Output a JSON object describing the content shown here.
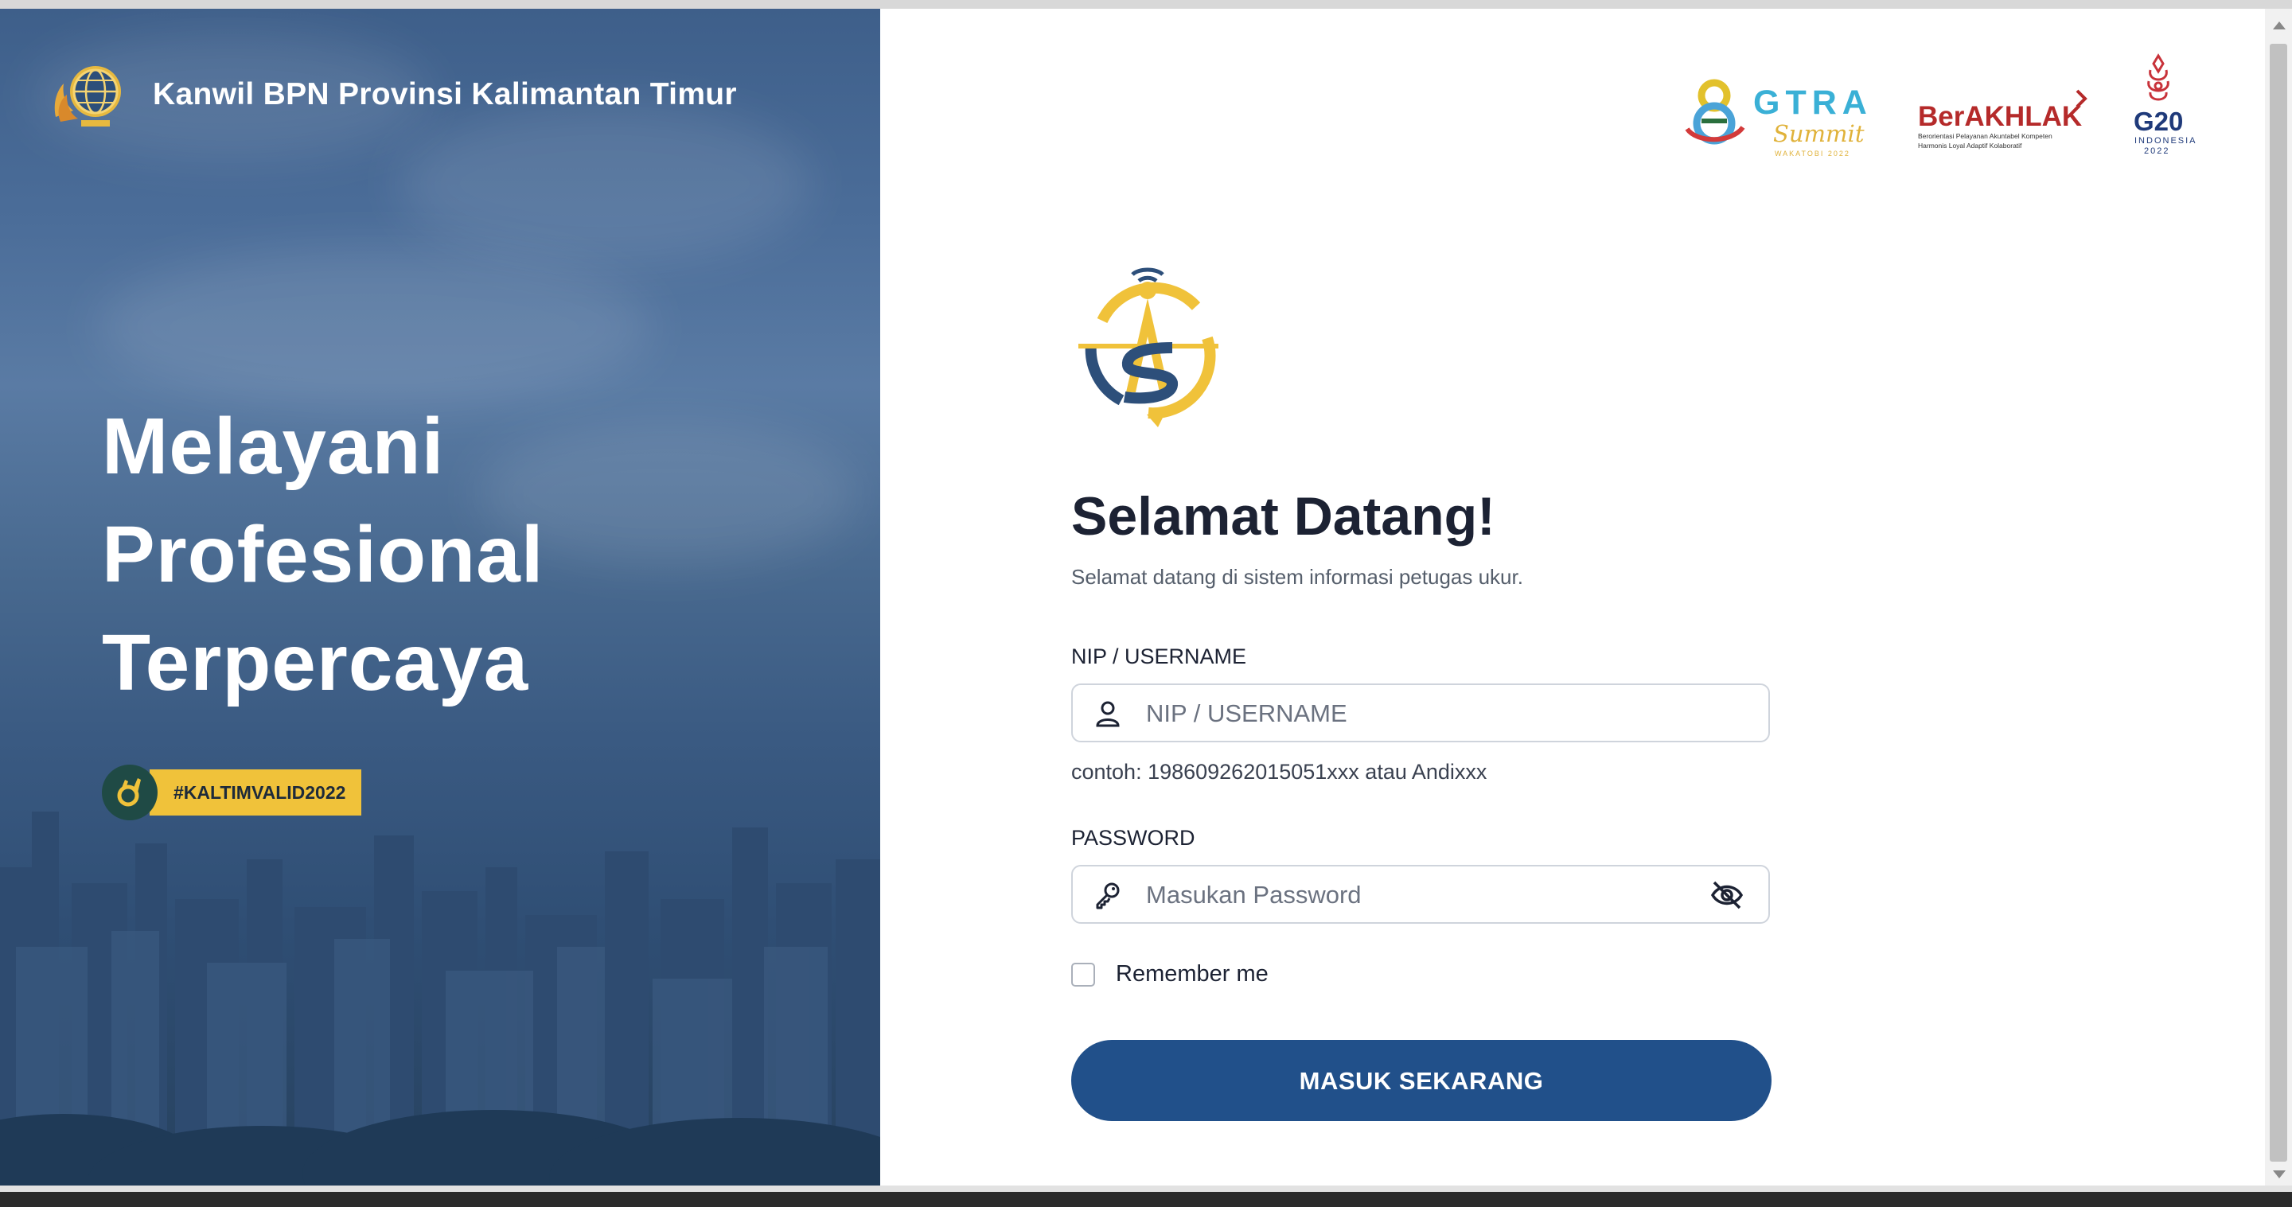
{
  "brand": {
    "title": "Kanwil BPN Provinsi Kalimantan Timur"
  },
  "hero": {
    "line1": "Melayani",
    "line2": "Profesional",
    "line3": "Terpercaya",
    "hashtag": "#KALTIMVALID2022"
  },
  "partners": {
    "gtra_name": "GTRA",
    "gtra_script": "Summit",
    "gtra_sub": "WAKATOBI 2022",
    "berakhlak_name": "BerAKHLAK",
    "berakhlak_sub1": "Berorientasi Pelayanan Akuntabel Kompeten",
    "berakhlak_sub2": "Harmonis Loyal Adaptif Kolaboratif",
    "g20_name": "G20",
    "g20_sub1": "INDONESIA",
    "g20_sub2": "2022"
  },
  "form": {
    "title": "Selamat Datang!",
    "subtitle": "Selamat datang di sistem informasi petugas ukur.",
    "username_label": "NIP / USERNAME",
    "username_placeholder": "NIP / USERNAME",
    "username_hint": "contoh: 198609262015051xxx atau Andixxx",
    "password_label": "PASSWORD",
    "password_placeholder": "Masukan Password",
    "remember_label": "Remember me",
    "submit_label": "MASUK SEKARANG"
  },
  "colors": {
    "primary": "#21508a",
    "accent": "#f0c23a",
    "text": "#1c2233"
  },
  "icons": {
    "username": "user-icon",
    "password": "key-icon",
    "toggle": "eye-off-icon"
  }
}
